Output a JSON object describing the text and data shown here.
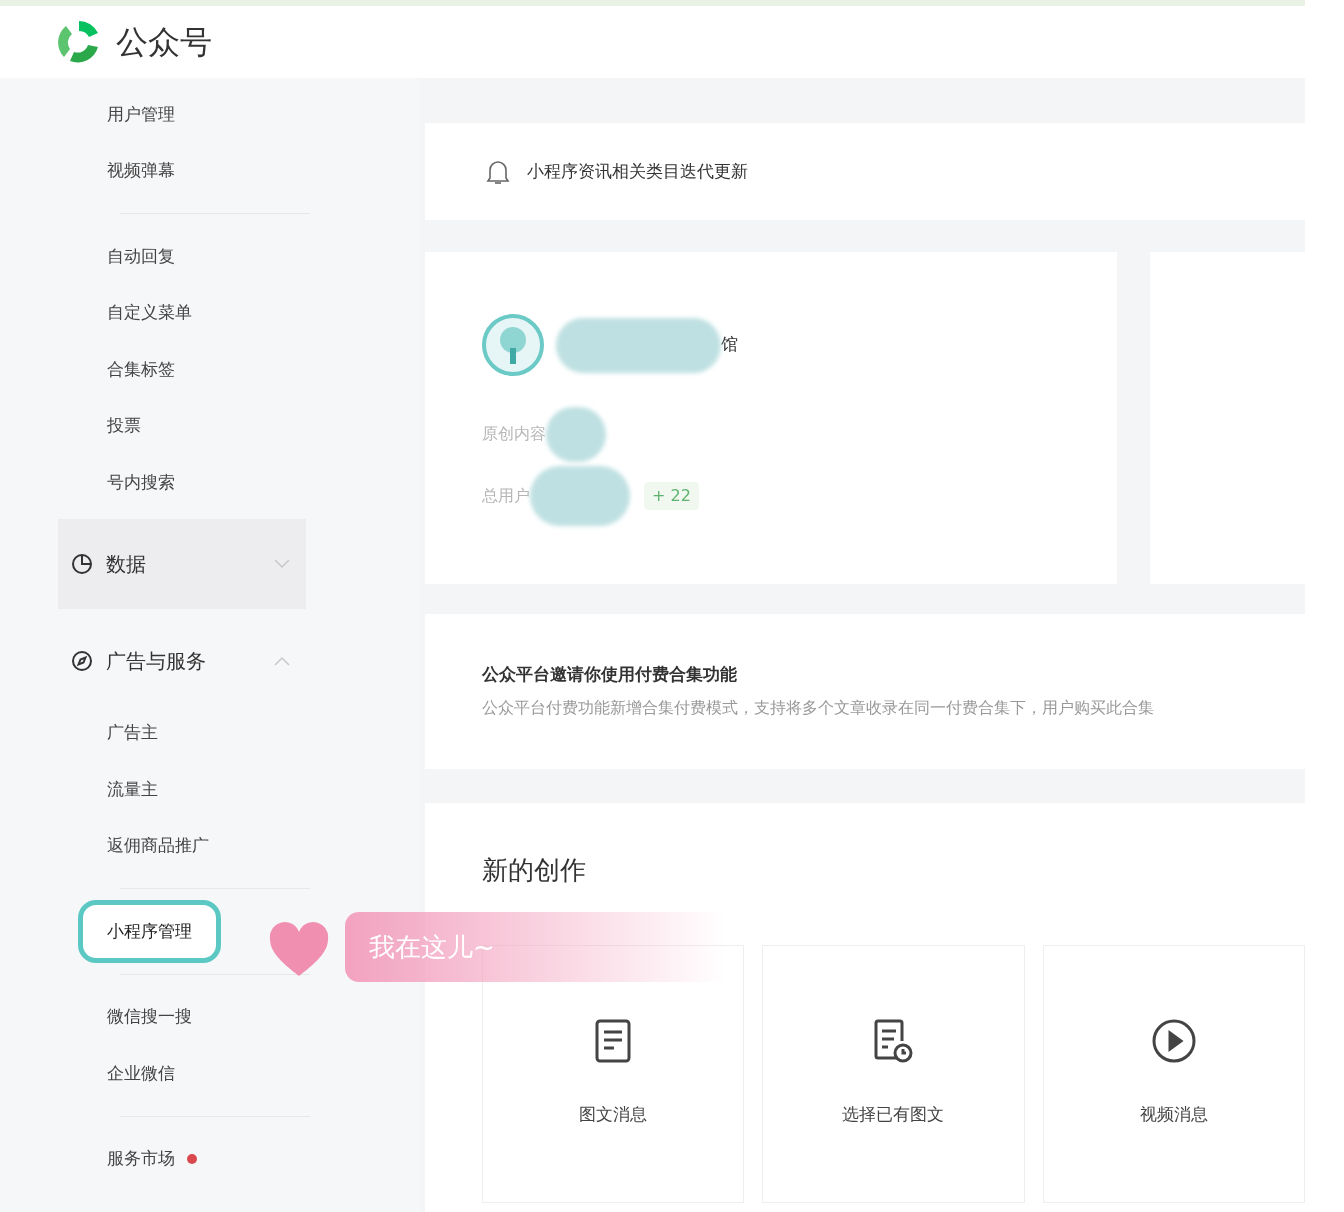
{
  "header": {
    "title": "公众号"
  },
  "sidebar": {
    "sections": [
      {
        "kind": "list",
        "items": [
          {
            "label": "用户管理",
            "selected": false
          },
          {
            "label": "视频弹幕",
            "selected": false
          }
        ]
      },
      {
        "kind": "list",
        "items": [
          {
            "label": "自动回复",
            "selected": false
          },
          {
            "label": "自定义菜单",
            "selected": false
          },
          {
            "label": "合集标签",
            "selected": false
          },
          {
            "label": "投票",
            "selected": false
          },
          {
            "label": "号内搜索",
            "selected": false
          }
        ]
      },
      {
        "kind": "group",
        "label": "数据",
        "expanded": false,
        "hovered": true
      },
      {
        "kind": "group",
        "label": "广告与服务",
        "expanded": true,
        "hovered": false
      },
      {
        "kind": "list",
        "items": [
          {
            "label": "广告主",
            "selected": false
          },
          {
            "label": "流量主",
            "selected": false
          },
          {
            "label": "返佣商品推广",
            "selected": false
          }
        ]
      },
      {
        "kind": "list",
        "items": [
          {
            "label": "小程序管理",
            "selected": true
          }
        ]
      },
      {
        "kind": "list",
        "items": [
          {
            "label": "微信搜一搜",
            "selected": false
          },
          {
            "label": "企业微信",
            "selected": false
          }
        ]
      },
      {
        "kind": "list",
        "items": [
          {
            "label": "服务市场",
            "selected": false,
            "badge_dot": true
          }
        ]
      }
    ]
  },
  "annotation": {
    "text": "我在这儿~"
  },
  "notice": {
    "text": "小程序资讯相关类目迭代更新"
  },
  "account": {
    "name_visible": "馆",
    "stats": [
      {
        "label": "原创内容"
      },
      {
        "label": "总用户",
        "delta": "+ 22"
      }
    ]
  },
  "promo": {
    "title": "公众平台邀请你使用付费合集功能",
    "text": "公众平台付费功能新增合集付费模式，支持将多个文章收录在同一付费合集下，用户购买此合集"
  },
  "creation": {
    "title": "新的创作",
    "tiles": [
      {
        "kind": "article",
        "label": "图文消息"
      },
      {
        "kind": "existing",
        "label": "选择已有图文"
      },
      {
        "kind": "video",
        "label": "视频消息"
      }
    ]
  }
}
